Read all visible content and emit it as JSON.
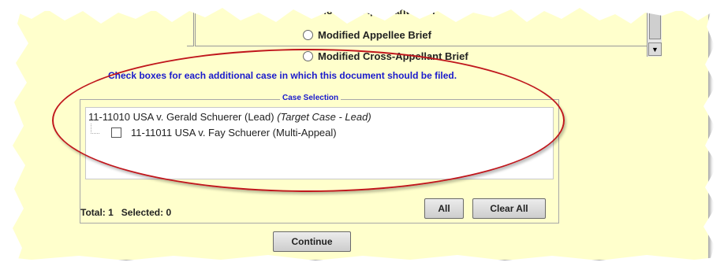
{
  "top_list": {
    "items": [
      {
        "label": "Modified Appellant Brief"
      },
      {
        "label": "Modified Appellee Brief"
      },
      {
        "label": "Modified Cross-Appellant Brief"
      }
    ]
  },
  "instruction": "Check boxes for each additional case in which this document should be filed.",
  "case_selection": {
    "legend": "Case Selection",
    "lead": {
      "case": "11-11010 USA v. Gerald Schuerer (Lead)",
      "note": "(Target Case - Lead)"
    },
    "children": [
      {
        "case": "11-11011 USA v. Fay Schuerer (Multi-Appeal)",
        "checked": false
      }
    ]
  },
  "totals": {
    "text": "Total: 1   Selected: 0"
  },
  "buttons": {
    "all": "All",
    "clear_all": "Clear All",
    "continue": "Continue"
  },
  "colors": {
    "panel_bg": "#ffffcc",
    "label_blue": "#1a1acc",
    "highlight_ellipse": "#c0171d"
  }
}
